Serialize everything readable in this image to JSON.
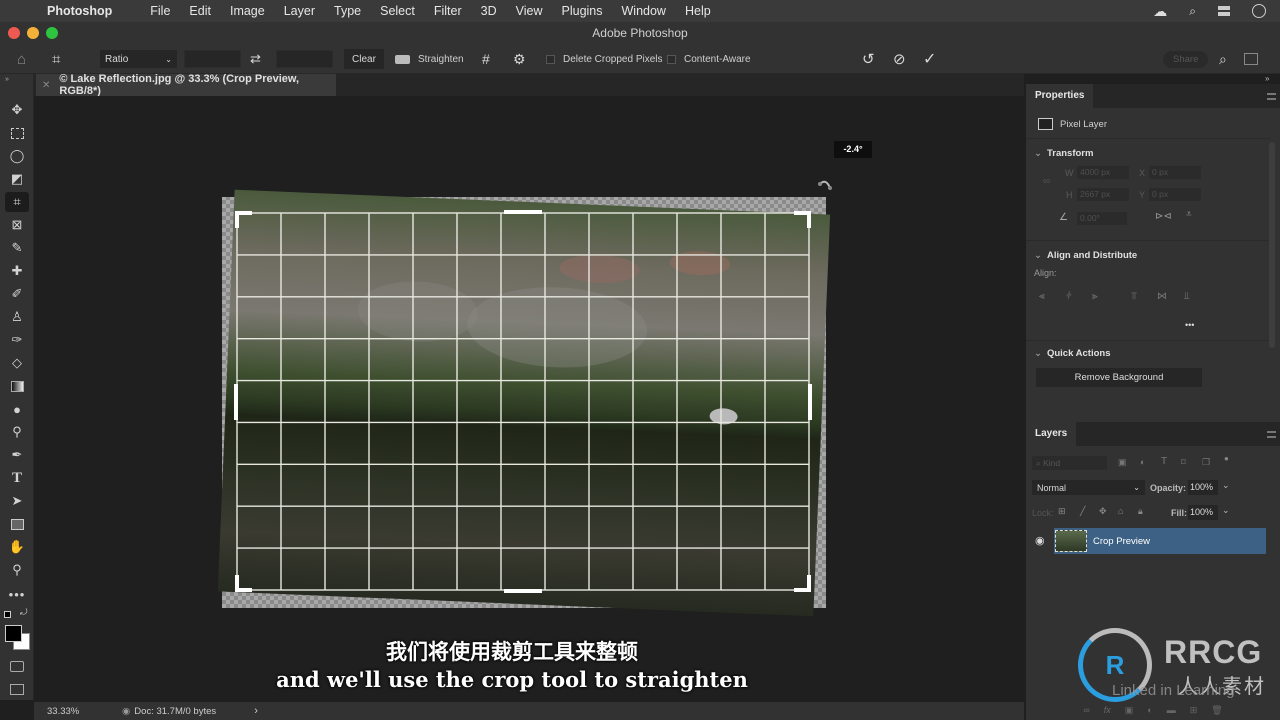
{
  "menubar": {
    "app_name": "Photoshop",
    "items": [
      "File",
      "Edit",
      "Image",
      "Layer",
      "Type",
      "Select",
      "Filter",
      "3D",
      "View",
      "Plugins",
      "Window",
      "Help"
    ],
    "right_icons": [
      "creative-cloud-icon",
      "search-icon",
      "control-center-icon",
      "siri-icon"
    ]
  },
  "window": {
    "title": "Adobe Photoshop",
    "traffic_lights": {
      "close": "#ee5a52",
      "minimize": "#f4b13a",
      "maximize": "#2ec440"
    }
  },
  "options_bar": {
    "ratio_label": "Ratio",
    "clear_label": "Clear",
    "straighten_label": "Straighten",
    "delete_cropped_label": "Delete Cropped Pixels",
    "delete_cropped_checked": false,
    "content_aware_label": "Content-Aware",
    "content_aware_checked": false,
    "share_label": "Share"
  },
  "document": {
    "tab_label": "© Lake Reflection.jpg @ 33.3% (Crop Preview, RGB/8*)",
    "angle_readout": "-2.4°"
  },
  "status_bar": {
    "zoom": "33.33%",
    "doc_info": "Doc: 31.7M/0 bytes"
  },
  "tools": [
    "move",
    "marquee",
    "lasso",
    "object-select",
    "crop",
    "frame",
    "eyedropper",
    "healing",
    "brush",
    "stamp",
    "history-brush",
    "eraser",
    "gradient",
    "blur",
    "dodge",
    "pen",
    "type",
    "path-select",
    "rectangle",
    "hand",
    "zoom",
    "more"
  ],
  "colors": {
    "foreground": "#000000",
    "background": "#ffffff",
    "panel": "#323232",
    "accent": "#3d6185"
  },
  "properties": {
    "tab": "Properties",
    "layer_type": "Pixel Layer",
    "transform_title": "Transform",
    "w_label": "W",
    "w_value": "4000 px",
    "x_label": "X",
    "x_value": "0 px",
    "h_label": "H",
    "h_value": "2667 px",
    "y_label": "Y",
    "y_value": "0 px",
    "angle_value": "0.00°",
    "align_title": "Align and Distribute",
    "align_label": "Align:",
    "more_label": "•••",
    "quick_actions_title": "Quick Actions",
    "remove_bg_label": "Remove Background"
  },
  "layers": {
    "tab": "Layers",
    "kind_placeholder": "Kind",
    "blend_mode": "Normal",
    "opacity_label": "Opacity:",
    "opacity_value": "100%",
    "lock_label": "Lock:",
    "fill_label": "Fill:",
    "fill_value": "100%",
    "items": [
      {
        "name": "Crop Preview",
        "visible": true,
        "selected": true
      }
    ]
  },
  "subtitles": {
    "chinese": "我们将使用裁剪工具来整顿",
    "english": "and we'll use the crop tool to straighten"
  },
  "watermark": {
    "brand": "RRCG",
    "chinese": "人人素材",
    "linkedin": "Linked in Learning"
  }
}
